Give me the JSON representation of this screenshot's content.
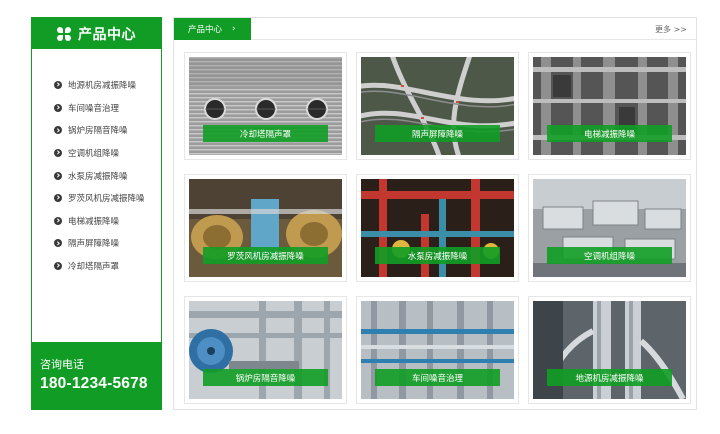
{
  "sidebar": {
    "title": "产品中心",
    "icon": "clover-icon",
    "items": [
      {
        "label": "地源机房减振降噪"
      },
      {
        "label": "车间噪音治理"
      },
      {
        "label": "锅炉房隔音降噪"
      },
      {
        "label": "空调机组降噪"
      },
      {
        "label": "水泵房减振降噪"
      },
      {
        "label": "罗茨风机房减振降噪"
      },
      {
        "label": "电梯减振降噪"
      },
      {
        "label": "隔声屏障降噪"
      },
      {
        "label": "冷却塔隔声罩"
      }
    ],
    "contact_label": "咨询电话",
    "phone": "180-1234-5678"
  },
  "main": {
    "tab_label": "产品中心",
    "more_label": "更多 >>",
    "products": [
      {
        "label": "冷却塔隔声罩"
      },
      {
        "label": "隔声屏障降噪"
      },
      {
        "label": "电梯减振降噪"
      },
      {
        "label": "罗茨风机房减振降噪"
      },
      {
        "label": "水泵房减振降噪"
      },
      {
        "label": "空调机组降噪"
      },
      {
        "label": "锅炉房隔音降噪"
      },
      {
        "label": "车间噪音治理"
      },
      {
        "label": "地源机房减振降噪"
      }
    ]
  },
  "colors": {
    "accent": "#119d25",
    "border": "#e2e2e2",
    "text": "#444444"
  }
}
